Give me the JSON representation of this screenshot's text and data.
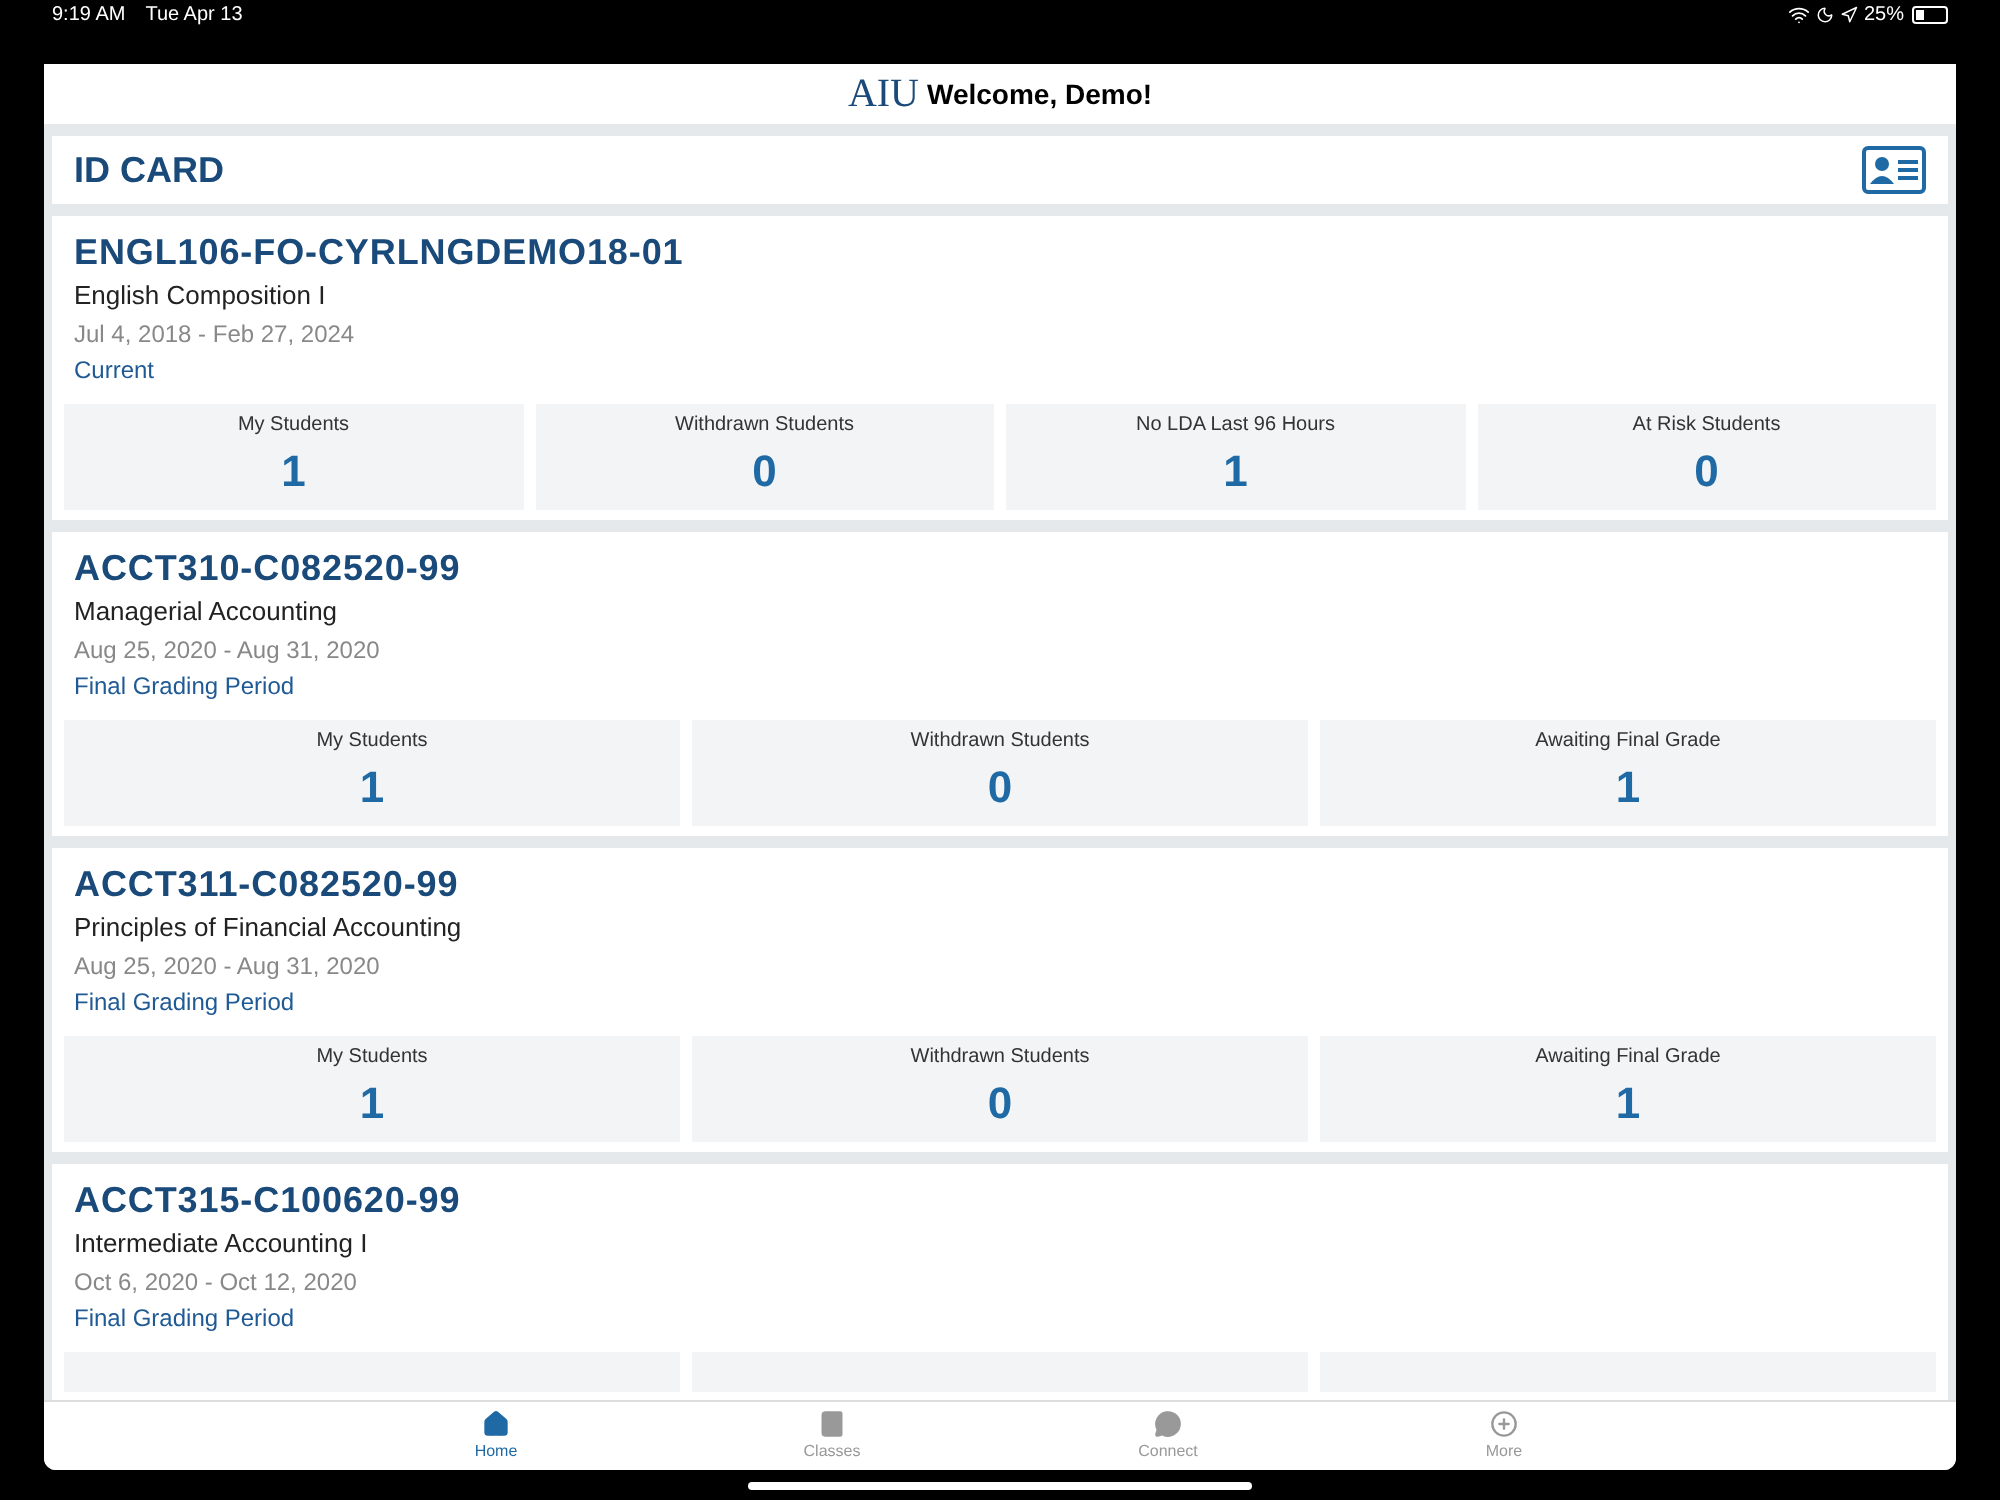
{
  "status_bar": {
    "time": "9:19 AM",
    "date": "Tue Apr 13",
    "battery": "25%"
  },
  "header": {
    "logo": "AIU",
    "title": "Welcome, Demo!"
  },
  "id_card": {
    "label": "ID CARD"
  },
  "courses": [
    {
      "code": "ENGL106-FO-CYRLNGDEMO18-01",
      "name": "English Composition I",
      "dates": "Jul 4, 2018 - Feb 27, 2024",
      "status": "Current",
      "stats": [
        {
          "label": "My Students",
          "value": "1"
        },
        {
          "label": "Withdrawn Students",
          "value": "0"
        },
        {
          "label": "No LDA Last 96 Hours",
          "value": "1"
        },
        {
          "label": "At Risk Students",
          "value": "0"
        }
      ]
    },
    {
      "code": "ACCT310-C082520-99",
      "name": "Managerial Accounting",
      "dates": "Aug 25, 2020 - Aug 31, 2020",
      "status": "Final Grading Period",
      "stats": [
        {
          "label": "My Students",
          "value": "1"
        },
        {
          "label": "Withdrawn Students",
          "value": "0"
        },
        {
          "label": "Awaiting Final Grade",
          "value": "1"
        }
      ]
    },
    {
      "code": "ACCT311-C082520-99",
      "name": "Principles of Financial Accounting",
      "dates": "Aug 25, 2020 - Aug 31, 2020",
      "status": "Final Grading Period",
      "stats": [
        {
          "label": "My Students",
          "value": "1"
        },
        {
          "label": "Withdrawn Students",
          "value": "0"
        },
        {
          "label": "Awaiting Final Grade",
          "value": "1"
        }
      ]
    },
    {
      "code": "ACCT315-C100620-99",
      "name": "Intermediate Accounting I",
      "dates": "Oct 6, 2020 - Oct 12, 2020",
      "status": "Final Grading Period",
      "stats_cut_off": true
    }
  ],
  "tabs": [
    {
      "label": "Home",
      "selected": true
    },
    {
      "label": "Classes",
      "selected": false
    },
    {
      "label": "Connect",
      "selected": false
    },
    {
      "label": "More",
      "selected": false
    }
  ]
}
